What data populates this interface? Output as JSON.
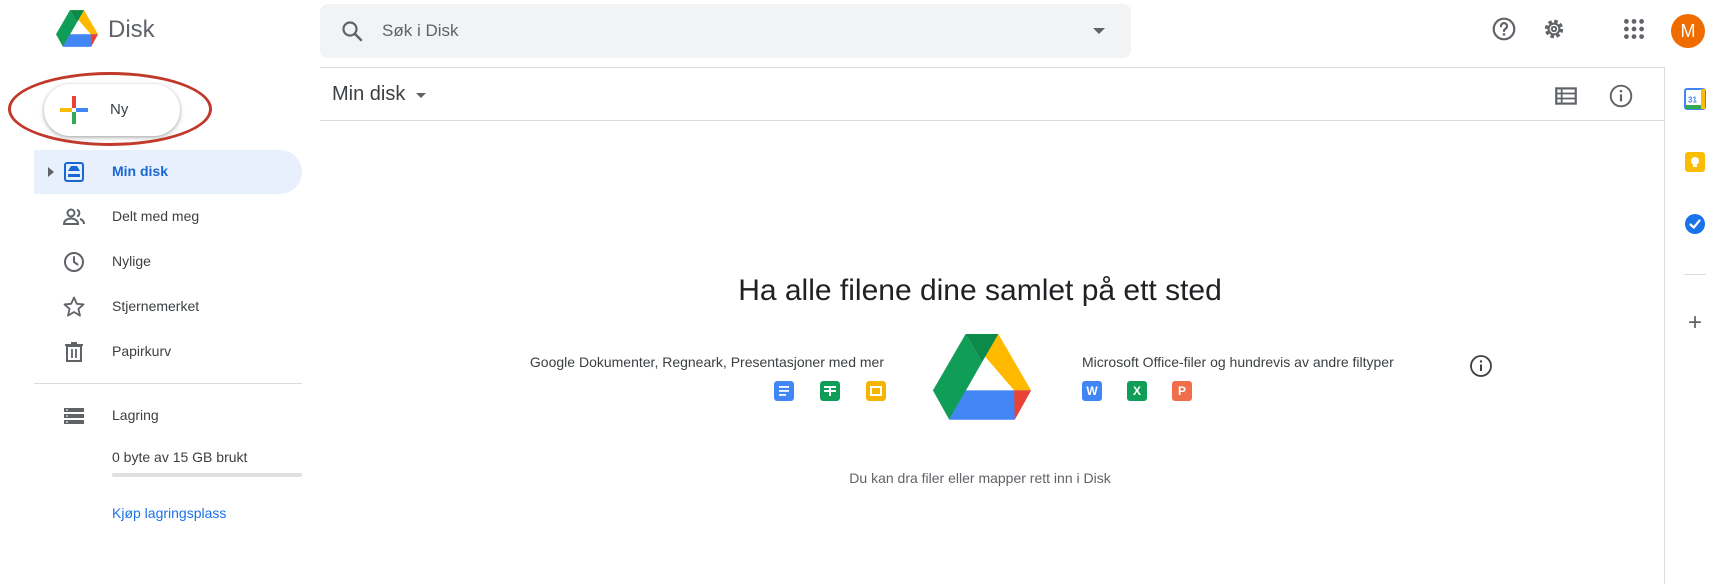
{
  "header": {
    "app_title": "Disk",
    "search_placeholder": "Søk i Disk",
    "avatar_initial": "M",
    "avatar_color": "#ef6c00"
  },
  "new_button": {
    "label": "Ny"
  },
  "sidebar": {
    "items": [
      {
        "label": "Min disk",
        "icon": "my-drive-icon",
        "active": true
      },
      {
        "label": "Delt med meg",
        "icon": "people-icon"
      },
      {
        "label": "Nylige",
        "icon": "clock-icon"
      },
      {
        "label": "Stjernemerket",
        "icon": "star-icon"
      },
      {
        "label": "Papirkurv",
        "icon": "trash-icon"
      }
    ],
    "storage": {
      "label": "Lagring",
      "usage_text": "0 byte av 15 GB brukt",
      "used_fraction": 0,
      "buy_link": "Kjøp lagringsplass"
    }
  },
  "toolbar": {
    "breadcrumb": "Min disk"
  },
  "empty_state": {
    "title": "Ha alle filene dine samlet på ett sted",
    "left_caption": "Google Dokumenter, Regneark, Presentasjoner med mer",
    "right_caption": "Microsoft Office-filer og hundrevis av andre filtyper",
    "office_letters": {
      "word": "W",
      "excel": "X",
      "powerpoint": "P"
    },
    "drop_hint": "Du kan dra filer eller mapper rett inn i Disk"
  },
  "right_rail": {
    "calendar_day": "31",
    "add_label": "+"
  },
  "colors": {
    "accent": "#1a73e8",
    "active_bg": "#e8f0fe",
    "annotation": "#c0392b"
  }
}
